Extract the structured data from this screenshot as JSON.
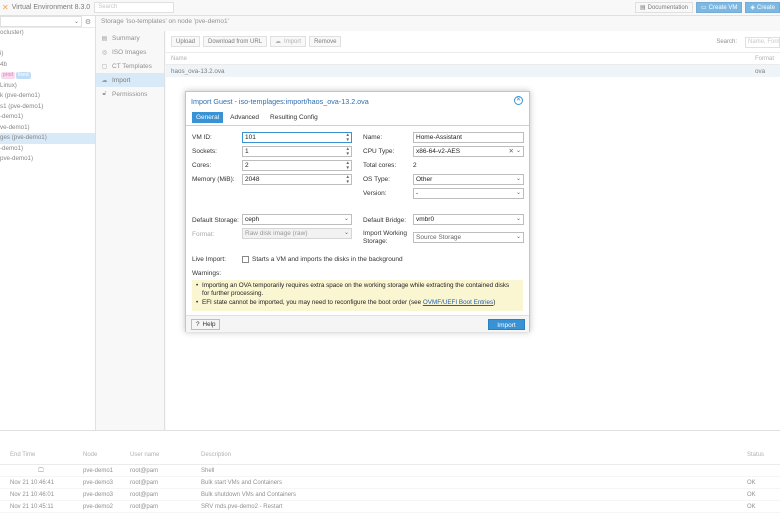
{
  "header": {
    "app_title": "Virtual Environment 8.3.0",
    "search_placeholder": "Search",
    "documentation": "Documentation",
    "create_vm": "Create VM",
    "create_ct": "Create"
  },
  "tree": {
    "items": [
      {
        "label": "ocluster)"
      },
      {
        "label": ""
      },
      {
        "label": "i)"
      },
      {
        "label": "4b"
      },
      {
        "label": ""
      },
      {
        "label": "Linux)"
      },
      {
        "label": "k (pve-demo1)"
      },
      {
        "label": "s1 (pve-demo1)"
      },
      {
        "label": "-demo1)"
      },
      {
        "label": "ve-demo1)"
      },
      {
        "label": "ges (pve-demo1)"
      },
      {
        "label": "-demo1)"
      },
      {
        "label": "pve-demo1)"
      }
    ],
    "tags": [
      "prod",
      "fixed"
    ]
  },
  "breadcrumb": "Storage 'iso-templates' on node 'pve-demo1'",
  "nav": {
    "items": [
      {
        "label": "Summary",
        "icon": "book-icon"
      },
      {
        "label": "ISO Images",
        "icon": "disc-icon"
      },
      {
        "label": "CT Templates",
        "icon": "file-icon"
      },
      {
        "label": "Import",
        "icon": "cloud-download-icon"
      },
      {
        "label": "Permissions",
        "icon": "unlock-icon"
      }
    ]
  },
  "toolbar": {
    "upload": "Upload",
    "download_url": "Download from URL",
    "import": "Import",
    "remove": "Remove",
    "search_label": "Search:",
    "search_placeholder": "Name, Format"
  },
  "grid": {
    "columns": [
      "Name",
      "Format"
    ],
    "rows": [
      {
        "name": "haos_ova-13.2.ova",
        "format": "ova"
      }
    ]
  },
  "dialog": {
    "title": "Import Guest - iso-templages:import/haos_ova-13.2.ova",
    "tabs": [
      "General",
      "Advanced",
      "Resulting Config"
    ],
    "left": {
      "vmid_label": "VM ID:",
      "vmid": "101",
      "sockets_label": "Sockets:",
      "sockets": "1",
      "cores_label": "Cores:",
      "cores": "2",
      "memory_label": "Memory (MiB):",
      "memory": "2048"
    },
    "right": {
      "name_label": "Name:",
      "name": "Home-Assistant",
      "cpu_label": "CPU Type:",
      "cpu": "x86-64-v2-AES",
      "total_label": "Total cores:",
      "total": "2",
      "ostype_label": "OS Type:",
      "ostype": "Other",
      "version_label": "Version:",
      "version": "-"
    },
    "storage": {
      "default_storage_label": "Default Storage:",
      "default_storage": "ceph",
      "format_label": "Format:",
      "format": "Raw disk image (raw)",
      "bridge_label": "Default Bridge:",
      "bridge": "vmbr0",
      "import_storage_label": "Import Working Storage:",
      "import_storage": "Source Storage"
    },
    "live_import_label": "Live Import:",
    "live_import_text": "Starts a VM and imports the disks in the background",
    "warnings_label": "Warnings:",
    "warnings": [
      "Importing an OVA temporarily requires extra space on the working storage while extracting the contained disks for further processing.",
      "EFI state cannot be imported, you may need to reconfigure the boot order (see"
    ],
    "warning_link": "OVMF/UEFI Boot Entries",
    "warning_tail": ")",
    "help": "Help",
    "import_btn": "Import"
  },
  "tasks": {
    "columns": [
      "End Time",
      "Node",
      "User name",
      "Description",
      "Status"
    ],
    "rows": [
      {
        "end": "",
        "node": "pve-demo1",
        "user": "root@pam",
        "desc": "Shell",
        "status": ""
      },
      {
        "end": "Nov 21 10:46:41",
        "node": "pve-demo3",
        "user": "root@pam",
        "desc": "Bulk start VMs and Containers",
        "status": "OK"
      },
      {
        "end": "Nov 21 10:46:01",
        "node": "pve-demo3",
        "user": "root@pam",
        "desc": "Bulk shutdown VMs and Containers",
        "status": "OK"
      },
      {
        "end": "Nov 21 10:45:11",
        "node": "pve-demo2",
        "user": "root@pam",
        "desc": "SRV mds.pve-demo2 - Restart",
        "status": "OK"
      }
    ]
  }
}
